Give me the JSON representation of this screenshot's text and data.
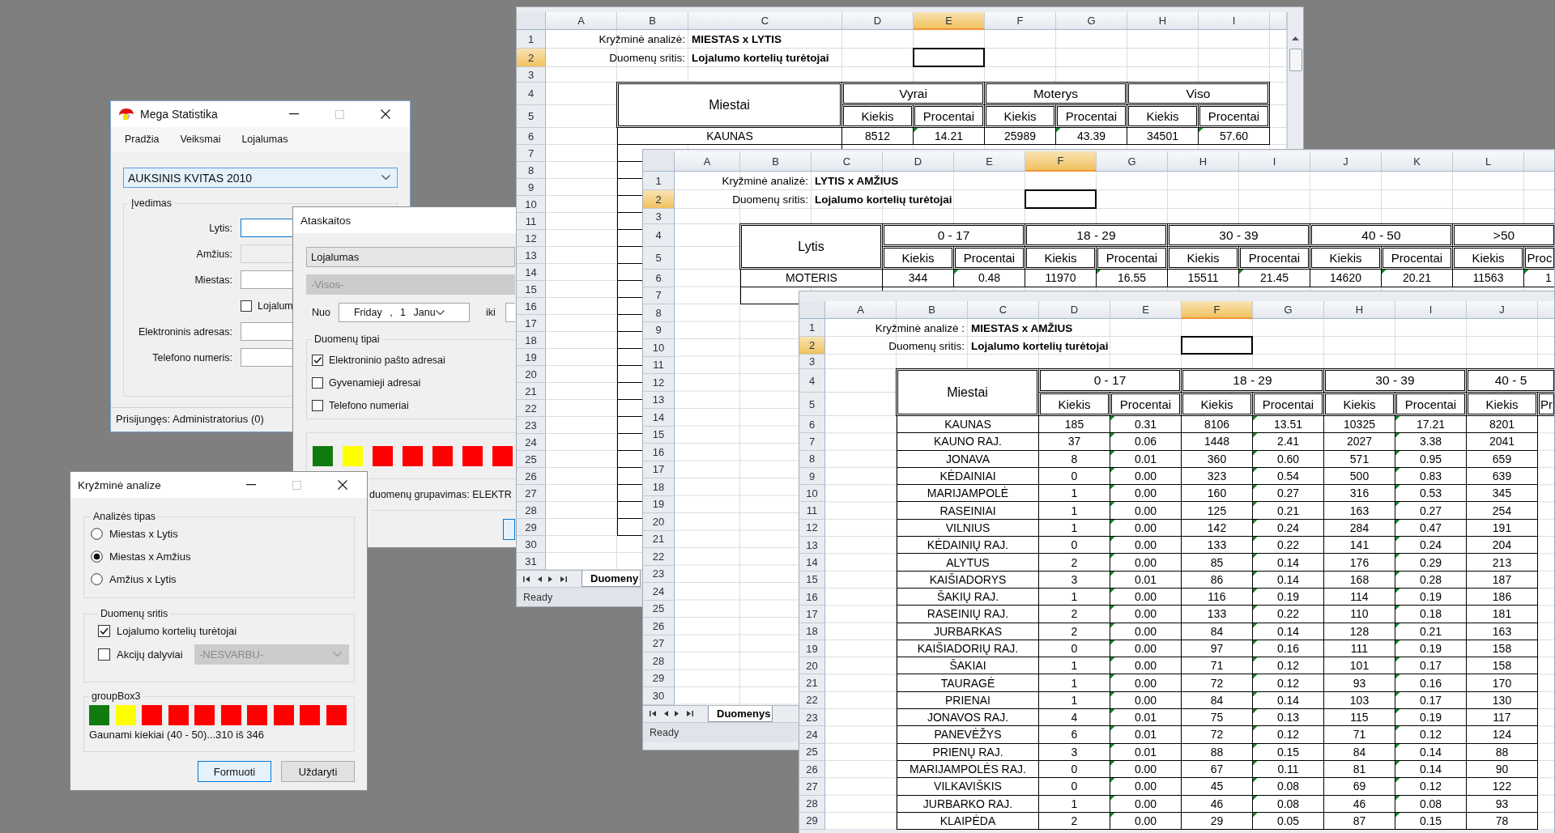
{
  "main_window": {
    "title": "Mega Statistika",
    "can_maximize": false,
    "menu": [
      "Pradžia",
      "Veiksmai",
      "Lojalumas"
    ],
    "campaign": {
      "value": "AUKSINIS KVITAS 2010",
      "focused": true
    },
    "input_group": {
      "title": "Įvedimas",
      "rows": [
        {
          "kind": "field",
          "label": "Lytis:",
          "focused": true,
          "disabled": false
        },
        {
          "kind": "field",
          "label": "Amžius:",
          "focused": false,
          "disabled": true
        },
        {
          "kind": "field",
          "label": "Miestas:",
          "focused": false,
          "disabled": false
        },
        {
          "kind": "checkbox",
          "label": "Lojalum",
          "checked": false
        },
        {
          "kind": "field",
          "label": "Elektroninis adresas:",
          "focused": false,
          "disabled": false
        },
        {
          "kind": "field",
          "label": "Telefono numeris:",
          "focused": false,
          "disabled": false
        }
      ]
    },
    "status": "Prisijungęs: Administratorius (0)"
  },
  "report_dialog": {
    "title": "Ataskaitos",
    "category": {
      "value": "Lojalumas",
      "disabled": false
    },
    "subcategory": {
      "value": "-Visos-",
      "disabled": true
    },
    "from_label": "Nuo",
    "from_date": "Friday , 1 Janu",
    "to_label": "iki",
    "data_types": {
      "title": "Duomenų tipai",
      "options": [
        {
          "label": "Elektroninio pašto adresai",
          "checked": true
        },
        {
          "label": "Gyvenamieji adresai",
          "checked": false
        },
        {
          "label": "Telefono numeriai",
          "checked": false
        }
      ]
    },
    "squares": [
      {
        "color": "#107c10"
      },
      {
        "color": "#ffff00"
      },
      {
        "color": "#ff0000"
      },
      {
        "color": "#ff0000"
      },
      {
        "color": "#ff0000"
      },
      {
        "color": "#ff0000"
      },
      {
        "color": "#ff0000"
      }
    ],
    "status": "duomenų grupavimas: ELEKTR"
  },
  "crosstab_dialog": {
    "title": "Kryžminė analize",
    "can_maximize": false,
    "analysis_type": {
      "title": "Analizės tipas",
      "options": [
        {
          "label": "Miestas x Lytis",
          "selected": false
        },
        {
          "label": "Miestas x Amžius",
          "selected": true
        },
        {
          "label": "Amžius x Lytis",
          "selected": false
        }
      ]
    },
    "data_scope": {
      "title": "Duomenų sritis",
      "options": [
        {
          "label": "Lojalumo kortelių turėtojai",
          "checked": true
        },
        {
          "label": "Akcijų dalyviai",
          "checked": false,
          "dropdown": {
            "value": "-NESVARBU-",
            "disabled": true
          }
        }
      ]
    },
    "progress": {
      "title": "groupBox3",
      "squares": [
        {
          "color": "#107c10"
        },
        {
          "color": "#ffff00"
        },
        {
          "color": "#ff0000"
        },
        {
          "color": "#ff0000"
        },
        {
          "color": "#ff0000"
        },
        {
          "color": "#ff0000"
        },
        {
          "color": "#ff0000"
        },
        {
          "color": "#ff0000"
        },
        {
          "color": "#ff0000"
        },
        {
          "color": "#ff0000"
        }
      ],
      "caption": "Gaunami kiekiai (40 - 50)...310 iš 346"
    },
    "buttons": [
      {
        "label": "Formuoti",
        "focused": true
      },
      {
        "label": "Uždaryti",
        "focused": false
      }
    ]
  },
  "spreadsheets": [
    {
      "columns": [
        {
          "label": "A",
          "selected": false
        },
        {
          "label": "B",
          "selected": false
        },
        {
          "label": "C",
          "selected": false
        },
        {
          "label": "D",
          "selected": false
        },
        {
          "label": "E",
          "selected": true
        },
        {
          "label": "F",
          "selected": false
        },
        {
          "label": "G",
          "selected": false
        },
        {
          "label": "H",
          "selected": false
        },
        {
          "label": "I",
          "selected": false
        }
      ],
      "row_headers": [
        {
          "label": "1",
          "selected": false
        },
        {
          "label": "2",
          "selected": true
        },
        {
          "label": "3",
          "selected": false
        },
        {
          "label": "4",
          "selected": false
        },
        {
          "label": "5",
          "selected": false
        },
        {
          "label": "6",
          "selected": false
        },
        {
          "label": "7",
          "selected": false
        },
        {
          "label": "8",
          "selected": false
        },
        {
          "label": "9",
          "selected": false
        },
        {
          "label": "10",
          "selected": false
        },
        {
          "label": "11",
          "selected": false
        },
        {
          "label": "12",
          "selected": false
        },
        {
          "label": "13",
          "selected": false
        },
        {
          "label": "14",
          "selected": false
        },
        {
          "label": "15",
          "selected": false
        },
        {
          "label": "16",
          "selected": false
        },
        {
          "label": "17",
          "selected": false
        },
        {
          "label": "18",
          "selected": false
        },
        {
          "label": "19",
          "selected": false
        },
        {
          "label": "20",
          "selected": false
        },
        {
          "label": "21",
          "selected": false
        },
        {
          "label": "22",
          "selected": false
        },
        {
          "label": "23",
          "selected": false
        },
        {
          "label": "24",
          "selected": false
        },
        {
          "label": "25",
          "selected": false
        },
        {
          "label": "26",
          "selected": false
        },
        {
          "label": "27",
          "selected": false
        },
        {
          "label": "28",
          "selected": false
        },
        {
          "label": "29",
          "selected": false
        },
        {
          "label": "30",
          "selected": false
        },
        {
          "label": "31",
          "selected": false
        }
      ],
      "title_label": "Kryžminė analizė:",
      "title_value": "MIESTAS x LYTIS",
      "scope_label": "Duomenų sritis:",
      "scope_value": "Lojalumo kortelių turėtojai",
      "table": {
        "corner": "Miestai",
        "groups": [
          "Vyrai",
          "Moterys",
          "Viso"
        ],
        "subheaders": [
          "Kiekis",
          "Procentai",
          "Kiekis",
          "Procentai",
          "Kiekis",
          "Procentai"
        ],
        "rows": [
          [
            "KAUNAS",
            "8512",
            "14.21",
            "25989",
            "43.39",
            "34501",
            "57.60"
          ]
        ]
      },
      "sheet_tab": "Duomeny",
      "status": "Ready"
    },
    {
      "columns": [
        {
          "label": "A",
          "selected": false
        },
        {
          "label": "B",
          "selected": false
        },
        {
          "label": "C",
          "selected": false
        },
        {
          "label": "D",
          "selected": false
        },
        {
          "label": "E",
          "selected": false
        },
        {
          "label": "F",
          "selected": true
        },
        {
          "label": "G",
          "selected": false
        },
        {
          "label": "H",
          "selected": false
        },
        {
          "label": "I",
          "selected": false
        },
        {
          "label": "J",
          "selected": false
        },
        {
          "label": "K",
          "selected": false
        },
        {
          "label": "L",
          "selected": false
        }
      ],
      "row_headers": [
        {
          "label": "1",
          "selected": false
        },
        {
          "label": "2",
          "selected": true
        },
        {
          "label": "3",
          "selected": false
        },
        {
          "label": "4",
          "selected": false
        },
        {
          "label": "5",
          "selected": false
        },
        {
          "label": "6",
          "selected": false
        },
        {
          "label": "7",
          "selected": false
        },
        {
          "label": "8",
          "selected": false
        },
        {
          "label": "9",
          "selected": false
        },
        {
          "label": "10",
          "selected": false
        },
        {
          "label": "11",
          "selected": false
        },
        {
          "label": "12",
          "selected": false
        },
        {
          "label": "13",
          "selected": false
        },
        {
          "label": "14",
          "selected": false
        },
        {
          "label": "15",
          "selected": false
        },
        {
          "label": "16",
          "selected": false
        },
        {
          "label": "17",
          "selected": false
        },
        {
          "label": "18",
          "selected": false
        },
        {
          "label": "19",
          "selected": false
        },
        {
          "label": "20",
          "selected": false
        },
        {
          "label": "21",
          "selected": false
        },
        {
          "label": "22",
          "selected": false
        },
        {
          "label": "23",
          "selected": false
        },
        {
          "label": "24",
          "selected": false
        },
        {
          "label": "25",
          "selected": false
        },
        {
          "label": "26",
          "selected": false
        },
        {
          "label": "27",
          "selected": false
        },
        {
          "label": "28",
          "selected": false
        },
        {
          "label": "29",
          "selected": false
        },
        {
          "label": "30",
          "selected": false
        }
      ],
      "title_label": "Kryžminė analizė:",
      "title_value": "LYTIS x AMŽIUS",
      "scope_label": "Duomenų sritis:",
      "scope_value": "Lojalumo kortelių turėtojai",
      "table": {
        "corner": "Lytis",
        "groups": [
          "0 - 17",
          "18 - 29",
          "30 - 39",
          "40 - 50",
          ">50"
        ],
        "subheaders": [
          "Kiekis",
          "Procentai",
          "Kiekis",
          "Procentai",
          "Kiekis",
          "Procentai",
          "Kiekis",
          "Procentai",
          "Kiekis",
          "Proc"
        ],
        "rows": [
          [
            "MOTERIS",
            "344",
            "0.48",
            "11970",
            "16.55",
            "15511",
            "21.45",
            "14620",
            "20.21",
            "11563",
            "1"
          ]
        ]
      },
      "sheet_tab": "Duomenys",
      "status": "Ready"
    },
    {
      "columns": [
        {
          "label": "A",
          "selected": false
        },
        {
          "label": "B",
          "selected": false
        },
        {
          "label": "C",
          "selected": false
        },
        {
          "label": "D",
          "selected": false
        },
        {
          "label": "E",
          "selected": false
        },
        {
          "label": "F",
          "selected": true
        },
        {
          "label": "G",
          "selected": false
        },
        {
          "label": "H",
          "selected": false
        },
        {
          "label": "I",
          "selected": false
        },
        {
          "label": "J",
          "selected": false
        }
      ],
      "row_headers": [
        {
          "label": "1",
          "selected": false
        },
        {
          "label": "2",
          "selected": true
        },
        {
          "label": "3",
          "selected": false
        },
        {
          "label": "4",
          "selected": false
        },
        {
          "label": "5",
          "selected": false
        },
        {
          "label": "6",
          "selected": false
        },
        {
          "label": "7",
          "selected": false
        },
        {
          "label": "8",
          "selected": false
        },
        {
          "label": "9",
          "selected": false
        },
        {
          "label": "10",
          "selected": false
        },
        {
          "label": "11",
          "selected": false
        },
        {
          "label": "12",
          "selected": false
        },
        {
          "label": "13",
          "selected": false
        },
        {
          "label": "14",
          "selected": false
        },
        {
          "label": "15",
          "selected": false
        },
        {
          "label": "16",
          "selected": false
        },
        {
          "label": "17",
          "selected": false
        },
        {
          "label": "18",
          "selected": false
        },
        {
          "label": "19",
          "selected": false
        },
        {
          "label": "20",
          "selected": false
        },
        {
          "label": "21",
          "selected": false
        },
        {
          "label": "22",
          "selected": false
        },
        {
          "label": "23",
          "selected": false
        },
        {
          "label": "24",
          "selected": false
        },
        {
          "label": "25",
          "selected": false
        },
        {
          "label": "26",
          "selected": false
        },
        {
          "label": "27",
          "selected": false
        },
        {
          "label": "28",
          "selected": false
        },
        {
          "label": "29",
          "selected": false
        }
      ],
      "title_label": "Kryžminė analizė :",
      "title_value": "MIESTAS x AMŽIUS",
      "scope_label": "Duomenų sritis:",
      "scope_value": "Lojalumo kortelių turėtojai",
      "table": {
        "corner": "Miestai",
        "groups": [
          "0 - 17",
          "18 - 29",
          "30 - 39",
          "40 - 5"
        ],
        "subheaders": [
          "Kiekis",
          "Procentai",
          "Kiekis",
          "Procentai",
          "Kiekis",
          "Procentai",
          "Kiekis",
          "Pr"
        ],
        "rows": [
          [
            "KAUNAS",
            "185",
            "0.31",
            "8106",
            "13.51",
            "10325",
            "17.21",
            "8201"
          ],
          [
            "KAUNO RAJ.",
            "37",
            "0.06",
            "1448",
            "2.41",
            "2027",
            "3.38",
            "2041"
          ],
          [
            "JONAVA",
            "8",
            "0.01",
            "360",
            "0.60",
            "571",
            "0.95",
            "659"
          ],
          [
            "KĖDAINIAI",
            "0",
            "0.00",
            "323",
            "0.54",
            "500",
            "0.83",
            "639"
          ],
          [
            "MARIJAMPOLĖ",
            "1",
            "0.00",
            "160",
            "0.27",
            "316",
            "0.53",
            "345"
          ],
          [
            "RASEINIAI",
            "1",
            "0.00",
            "125",
            "0.21",
            "163",
            "0.27",
            "254"
          ],
          [
            "VILNIUS",
            "1",
            "0.00",
            "142",
            "0.24",
            "284",
            "0.47",
            "191"
          ],
          [
            "KĖDAINIŲ RAJ.",
            "0",
            "0.00",
            "133",
            "0.22",
            "141",
            "0.24",
            "204"
          ],
          [
            "ALYTUS",
            "2",
            "0.00",
            "85",
            "0.14",
            "176",
            "0.29",
            "213"
          ],
          [
            "KAIŠIADORYS",
            "3",
            "0.01",
            "86",
            "0.14",
            "168",
            "0.28",
            "187"
          ],
          [
            "ŠAKIŲ RAJ.",
            "1",
            "0.00",
            "116",
            "0.19",
            "114",
            "0.19",
            "186"
          ],
          [
            "RASEINIŲ RAJ.",
            "2",
            "0.00",
            "133",
            "0.22",
            "110",
            "0.18",
            "181"
          ],
          [
            "JURBARKAS",
            "2",
            "0.00",
            "84",
            "0.14",
            "128",
            "0.21",
            "163"
          ],
          [
            "KAIŠIADORIŲ RAJ.",
            "0",
            "0.00",
            "97",
            "0.16",
            "111",
            "0.19",
            "158"
          ],
          [
            "ŠAKIAI",
            "1",
            "0.00",
            "71",
            "0.12",
            "101",
            "0.17",
            "158"
          ],
          [
            "TAURAGĖ",
            "1",
            "0.00",
            "72",
            "0.12",
            "93",
            "0.16",
            "170"
          ],
          [
            "PRIENAI",
            "1",
            "0.00",
            "84",
            "0.14",
            "103",
            "0.17",
            "130"
          ],
          [
            "JONAVOS RAJ.",
            "4",
            "0.01",
            "75",
            "0.13",
            "115",
            "0.19",
            "117"
          ],
          [
            "PANEVĖŽYS",
            "6",
            "0.01",
            "72",
            "0.12",
            "71",
            "0.12",
            "124"
          ],
          [
            "PRIENŲ RAJ.",
            "3",
            "0.01",
            "88",
            "0.15",
            "84",
            "0.14",
            "88"
          ],
          [
            "MARIJAMPOLĖS RAJ.",
            "0",
            "0.00",
            "67",
            "0.11",
            "81",
            "0.14",
            "90"
          ],
          [
            "VILKAVIŠKIS",
            "0",
            "0.00",
            "45",
            "0.08",
            "69",
            "0.12",
            "122"
          ],
          [
            "JURBARKO RAJ.",
            "1",
            "0.00",
            "46",
            "0.08",
            "46",
            "0.08",
            "93"
          ],
          [
            "KLAIPĖDA",
            "2",
            "0.00",
            "29",
            "0.05",
            "87",
            "0.15",
            "78"
          ]
        ]
      }
    }
  ]
}
